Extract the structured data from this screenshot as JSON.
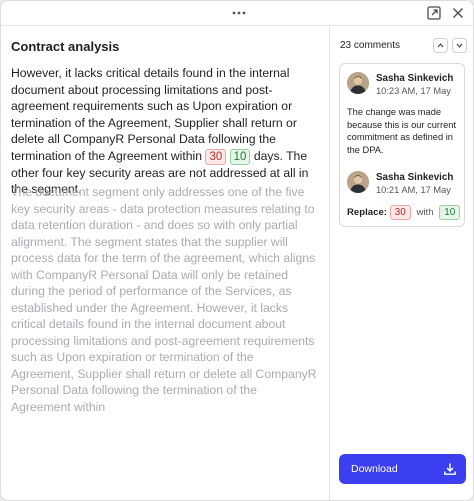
{
  "panel": {
    "title": "Contract analysis"
  },
  "document": {
    "active_before": "However, it lacks critical details found in the internal document about processing limitations and post-agreement requirements such as Upon expiration or termination of the Agreement, Supplier shall return or delete all CompanyR Personal Data following the termination of the Agreement within",
    "old_value": "30",
    "new_value": "10",
    "active_after": "days. The other four key security areas are not addressed at all in the segment.",
    "muted_text": "The document segment only addresses one of the five key security areas - data protection measures relating to data retention duration - and does so with only partial alignment. The segment states that the supplier will process data for the term of the agreement, which aligns with CompanyR Personal Data will only be retained during the period of performance of the Services, as established under the Agreement. However, it lacks critical details found in the internal document about processing limitations and post-agreement requirements such as Upon expiration or termination of the Agreement, Supplier shall return or delete all CompanyR Personal Data following the termination of the Agreement within"
  },
  "comments": {
    "count_label": "23 comments",
    "items": [
      {
        "author": "Sasha Sinkevich",
        "time": "10:23 AM, 17 May",
        "text": "The change was made because this is our current commitment as defined in the DPA."
      },
      {
        "author": "Sasha Sinkevich",
        "time": "10:21 AM, 17 May",
        "replace_label": "Replace:",
        "from": "30",
        "with_label": "with",
        "to": "10"
      }
    ]
  },
  "download": {
    "label": "Download"
  },
  "colors": {
    "accent": "#3b3ff0",
    "removed": "#b42b2b",
    "added": "#217a34"
  }
}
